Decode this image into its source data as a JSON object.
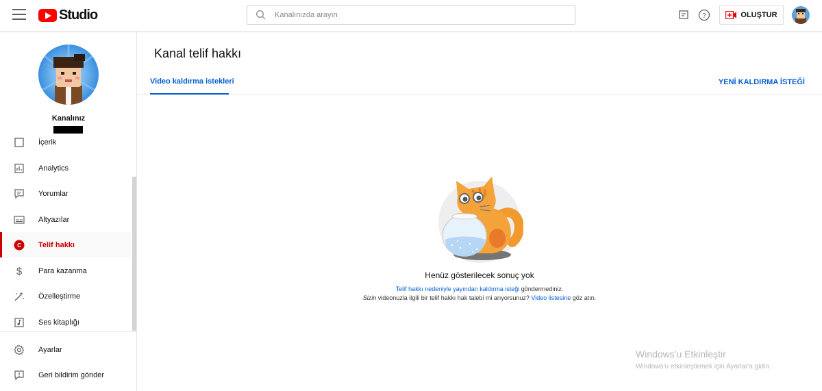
{
  "header": {
    "logo_text": "Studio",
    "search_placeholder": "Kanalınızda arayın",
    "create_label": "OLUŞTUR"
  },
  "sidebar": {
    "channel_label": "Kanalınız",
    "items": [
      {
        "label": "İçerik",
        "icon": "content-icon"
      },
      {
        "label": "Analytics",
        "icon": "analytics-icon"
      },
      {
        "label": "Yorumlar",
        "icon": "comments-icon"
      },
      {
        "label": "Altyazılar",
        "icon": "subtitles-icon"
      },
      {
        "label": "Telif hakkı",
        "icon": "copyright-icon"
      },
      {
        "label": "Para kazanma",
        "icon": "dollar-icon"
      },
      {
        "label": "Özelleştirme",
        "icon": "magic-wand-icon"
      },
      {
        "label": "Ses kitaplığı",
        "icon": "audio-library-icon"
      }
    ],
    "active_item": "Telif hakkı",
    "bottom_items": [
      {
        "label": "Ayarlar",
        "icon": "gear-icon"
      },
      {
        "label": "Geri bildirim gönder",
        "icon": "feedback-icon"
      }
    ]
  },
  "main": {
    "title": "Kanal telif hakkı",
    "tab_label": "Video kaldırma istekleri",
    "new_request_label": "YENİ KALDIRMA İSTEĞİ",
    "empty_title": "Henüz gösterilecek sonuç yok",
    "line1_link": "Telif hakkı nedeniyle yayından kaldırma isteği",
    "line1_rest": " göndermediniz.",
    "line2_italic": "Sizin",
    "line2_mid": " videonuzla ilgili bir telif hakkı hak talebi mi arıyorsunuz? ",
    "line2_link": "Video listesine",
    "line2_rest": " göz atın."
  },
  "watermark": {
    "title": "Windows'u Etkinleştir",
    "subtitle": "Windows'u etkinleştirmek için Ayarlar'a gidin."
  },
  "colors": {
    "accent_blue": "#065fd4",
    "active_red": "#cc0000",
    "brand_red": "#ff0000"
  }
}
